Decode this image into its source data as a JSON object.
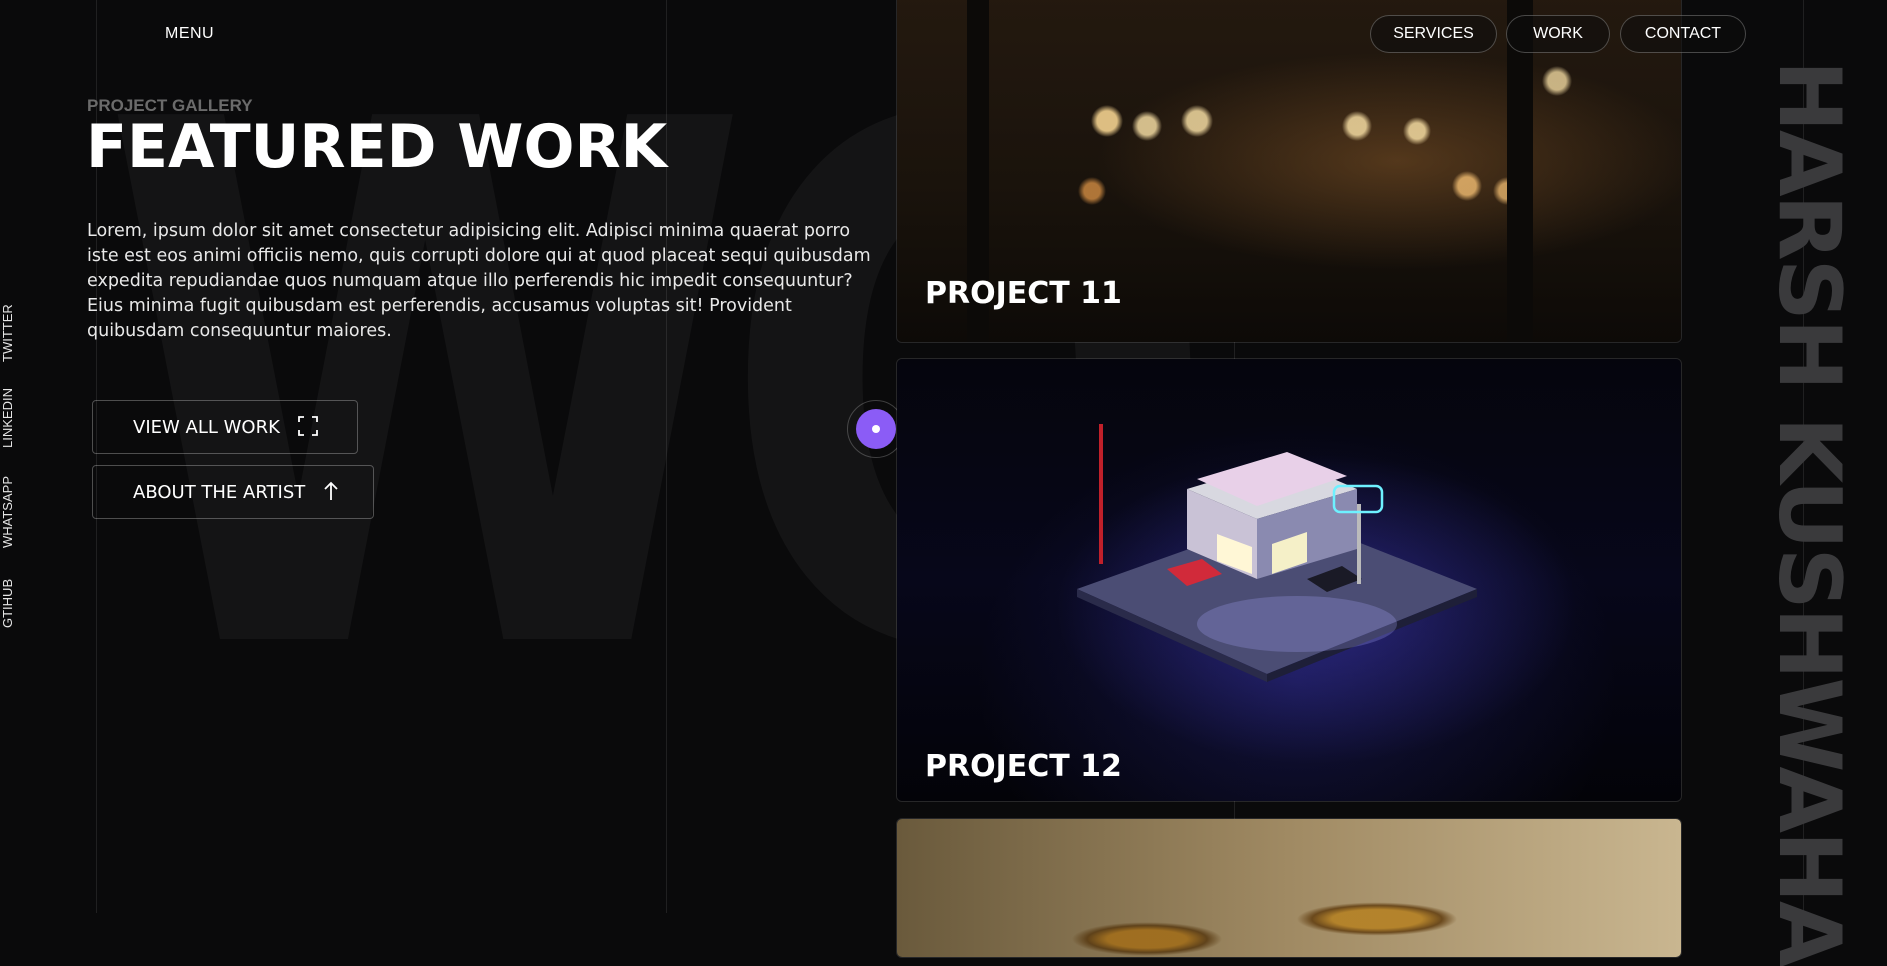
{
  "nav": {
    "menu_label": "MENU",
    "links": [
      "SERVICES",
      "WORK",
      "CONTACT"
    ]
  },
  "social": [
    "TWITTER",
    "LINKEDIN",
    "WHATSAPP",
    "GTIHUB"
  ],
  "background_word": "WO",
  "hero": {
    "kicker": "PROJECT GALLERY",
    "title": "FEATURED WORK",
    "description": "Lorem, ipsum dolor sit amet consectetur adipisicing elit. Adipisci minima quaerat porro iste est eos animi officiis nemo, quis corrupti dolore qui at quod placeat sequi quibusdam expedita repudiandae quos numquam atque illo perferendis hic impedit consequuntur? Eius minima fugit quibusdam est perferendis, accusamus voluptas sit! Provident quibusdam consequuntur maiores."
  },
  "buttons": {
    "view_all": "VIEW ALL WORK",
    "about": "ABOUT THE ARTIST"
  },
  "projects": [
    {
      "label": "PROJECT 11",
      "image": "blurred restaurant bar interior at night"
    },
    {
      "label": "PROJECT 12",
      "image": "isometric neon-lit supermarket diorama"
    },
    {
      "label": "",
      "image": "golden sculpture close-up"
    }
  ],
  "side_name": "HARSH KUSHWAHA",
  "colors": {
    "background": "#0a0a0b",
    "accent": "#8b5cf6",
    "muted_text": "#6b6b6b",
    "side_name": "#3a3a3c"
  },
  "icons": {
    "view_all": "expand-icon",
    "about": "arrow-up-icon"
  }
}
